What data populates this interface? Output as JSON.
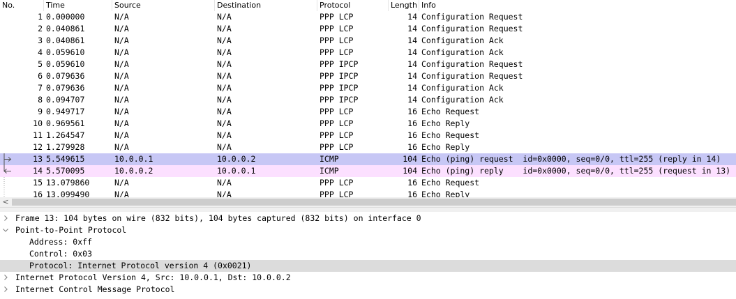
{
  "packet_list": {
    "columns": [
      "No.",
      "Time",
      "Source",
      "Destination",
      "Protocol",
      "Length",
      "Info"
    ],
    "rows": [
      {
        "no": "1",
        "time": "0.000000",
        "src": "N/A",
        "dst": "N/A",
        "proto": "PPP LCP",
        "len": "14",
        "info": "Configuration Request"
      },
      {
        "no": "2",
        "time": "0.040861",
        "src": "N/A",
        "dst": "N/A",
        "proto": "PPP LCP",
        "len": "14",
        "info": "Configuration Request"
      },
      {
        "no": "3",
        "time": "0.040861",
        "src": "N/A",
        "dst": "N/A",
        "proto": "PPP LCP",
        "len": "14",
        "info": "Configuration Ack"
      },
      {
        "no": "4",
        "time": "0.059610",
        "src": "N/A",
        "dst": "N/A",
        "proto": "PPP LCP",
        "len": "14",
        "info": "Configuration Ack"
      },
      {
        "no": "5",
        "time": "0.059610",
        "src": "N/A",
        "dst": "N/A",
        "proto": "PPP IPCP",
        "len": "14",
        "info": "Configuration Request"
      },
      {
        "no": "6",
        "time": "0.079636",
        "src": "N/A",
        "dst": "N/A",
        "proto": "PPP IPCP",
        "len": "14",
        "info": "Configuration Request"
      },
      {
        "no": "7",
        "time": "0.079636",
        "src": "N/A",
        "dst": "N/A",
        "proto": "PPP IPCP",
        "len": "14",
        "info": "Configuration Ack"
      },
      {
        "no": "8",
        "time": "0.094707",
        "src": "N/A",
        "dst": "N/A",
        "proto": "PPP IPCP",
        "len": "14",
        "info": "Configuration Ack"
      },
      {
        "no": "9",
        "time": "0.949717",
        "src": "N/A",
        "dst": "N/A",
        "proto": "PPP LCP",
        "len": "16",
        "info": "Echo Request"
      },
      {
        "no": "10",
        "time": "0.969561",
        "src": "N/A",
        "dst": "N/A",
        "proto": "PPP LCP",
        "len": "16",
        "info": "Echo Reply"
      },
      {
        "no": "11",
        "time": "1.264547",
        "src": "N/A",
        "dst": "N/A",
        "proto": "PPP LCP",
        "len": "16",
        "info": "Echo Request"
      },
      {
        "no": "12",
        "time": "1.279928",
        "src": "N/A",
        "dst": "N/A",
        "proto": "PPP LCP",
        "len": "16",
        "info": "Echo Reply"
      },
      {
        "no": "13",
        "time": "5.549615",
        "src": "10.0.0.1",
        "dst": "10.0.0.2",
        "proto": "ICMP",
        "len": "104",
        "info": "Echo (ping) request  id=0x0000, seq=0/0, ttl=255 (reply in 14)",
        "bg": "#c7c7f5",
        "mark": "request"
      },
      {
        "no": "14",
        "time": "5.570095",
        "src": "10.0.0.2",
        "dst": "10.0.0.1",
        "proto": "ICMP",
        "len": "104",
        "info": "Echo (ping) reply    id=0x0000, seq=0/0, ttl=255 (request in 13)",
        "bg": "#fce0ff",
        "mark": "reply"
      },
      {
        "no": "15",
        "time": "13.079860",
        "src": "N/A",
        "dst": "N/A",
        "proto": "PPP LCP",
        "len": "16",
        "info": "Echo Request"
      },
      {
        "no": "16",
        "time": "13.099490",
        "src": "N/A",
        "dst": "N/A",
        "proto": "PPP LCP",
        "len": "16",
        "info": "Echo Reply"
      }
    ]
  },
  "scrollbar": {
    "left_arrow": "<"
  },
  "details": {
    "rows": [
      {
        "expander": "collapsed",
        "indent": 0,
        "text": "Frame 13: 104 bytes on wire (832 bits), 104 bytes captured (832 bits) on interface 0"
      },
      {
        "expander": "expanded",
        "indent": 0,
        "text": "Point-to-Point Protocol"
      },
      {
        "expander": "none",
        "indent": 1,
        "text": "Address: 0xff"
      },
      {
        "expander": "none",
        "indent": 1,
        "text": "Control: 0x03"
      },
      {
        "expander": "none",
        "indent": 1,
        "text": "Protocol: Internet Protocol version 4 (0x0021)",
        "selected": true
      },
      {
        "expander": "collapsed",
        "indent": 0,
        "text": "Internet Protocol Version 4, Src: 10.0.0.1, Dst: 10.0.0.2"
      },
      {
        "expander": "collapsed",
        "indent": 0,
        "text": "Internet Control Message Protocol"
      }
    ]
  },
  "colors": {
    "icmp_request_row": "#c7c7f5",
    "icmp_reply_row": "#fce0ff",
    "selected_detail": "#dcdcdc"
  },
  "icons": {
    "collapsed": "chevron-right-icon",
    "expanded": "chevron-down-icon",
    "request_mark": "related-request-icon",
    "reply_mark": "related-reply-icon"
  }
}
